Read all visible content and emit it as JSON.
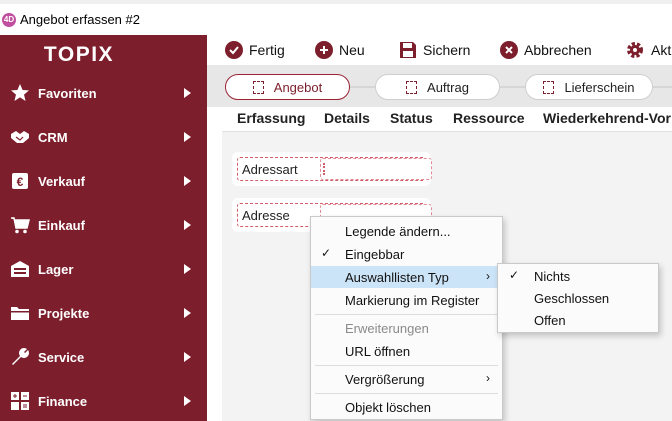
{
  "window": {
    "title": "Angebot erfassen #2",
    "app_icon": "4D"
  },
  "sidebar": {
    "logo": "TOPIX",
    "items": [
      {
        "label": "Favoriten",
        "icon": "star-icon"
      },
      {
        "label": "CRM",
        "icon": "handshake-icon"
      },
      {
        "label": "Verkauf",
        "icon": "sales-icon"
      },
      {
        "label": "Einkauf",
        "icon": "cart-icon"
      },
      {
        "label": "Lager",
        "icon": "warehouse-icon"
      },
      {
        "label": "Projekte",
        "icon": "folder-icon"
      },
      {
        "label": "Service",
        "icon": "wrench-icon"
      },
      {
        "label": "Finance",
        "icon": "calculator-icon"
      }
    ]
  },
  "toolbar": {
    "fertig": "Fertig",
    "neu": "Neu",
    "sichern": "Sichern",
    "abbrechen": "Abbrechen",
    "aktionen": "Akti"
  },
  "workflow": [
    "Angebot",
    "Auftrag",
    "Lieferschein"
  ],
  "tabs": [
    "Erfassung",
    "Details",
    "Status",
    "Ressource",
    "Wiederkehrend-Vor"
  ],
  "form": {
    "adressart_label": "Adressart",
    "adresse_label": "Adresse"
  },
  "context_menu": {
    "legende": "Legende ändern...",
    "eingebbar": "Eingebbar",
    "auswahllisten": "Auswahllisten Typ",
    "markierung": "Markierung im Register",
    "erweiterungen": "Erweiterungen",
    "url": "URL öffnen",
    "vergroesserung": "Vergrößerung",
    "loeschen": "Objekt löschen"
  },
  "submenu": {
    "nichts": "Nichts",
    "geschlossen": "Geschlossen",
    "offen": "Offen"
  },
  "colors": {
    "brand": "#7d1e2c",
    "highlight": "#cce4f7"
  }
}
